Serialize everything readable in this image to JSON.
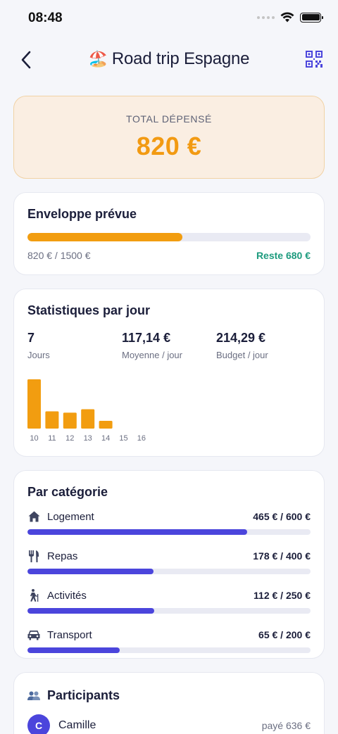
{
  "status": {
    "time": "08:48"
  },
  "header": {
    "emoji": "🏖️",
    "title": "Road trip Espagne"
  },
  "total": {
    "label": "TOTAL DÉPENSÉ",
    "value": "820 €"
  },
  "envelope": {
    "title": "Enveloppe prévue",
    "amount": "820 € / 1500 €",
    "remaining": "Reste 680 €",
    "progress_fraction": 0.5467,
    "bar_color": "#f29d10"
  },
  "stats": {
    "title": "Statistiques par jour",
    "items": [
      {
        "value": "7",
        "label": "Jours"
      },
      {
        "value": "117,14 €",
        "label": "Moyenne / jour"
      },
      {
        "value": "214,29 €",
        "label": "Budget / jour"
      }
    ]
  },
  "chart_data": {
    "type": "bar",
    "categories": [
      "10",
      "11",
      "12",
      "13",
      "14",
      "15",
      "16"
    ],
    "values": [
      285,
      100,
      92,
      112,
      45,
      0,
      0
    ],
    "ylim": [
      0,
      285
    ],
    "bar_color": "#f29d10",
    "grid": false
  },
  "categories": {
    "title": "Par catégorie",
    "items": [
      {
        "icon": "home-icon",
        "name": "Logement",
        "value": "465 € / 600 €",
        "fraction": 0.775
      },
      {
        "icon": "utensils-icon",
        "name": "Repas",
        "value": "178 € / 400 €",
        "fraction": 0.445
      },
      {
        "icon": "hiking-icon",
        "name": "Activités",
        "value": "112 € / 250 €",
        "fraction": 0.448
      },
      {
        "icon": "car-icon",
        "name": "Transport",
        "value": "65 € / 200 €",
        "fraction": 0.325
      }
    ],
    "bar_color": "#4b45dc"
  },
  "participants": {
    "title": "Participants",
    "icon": "people-icon",
    "items": [
      {
        "initial": "C",
        "name": "Camille",
        "paid": "payé 636 €"
      }
    ]
  }
}
